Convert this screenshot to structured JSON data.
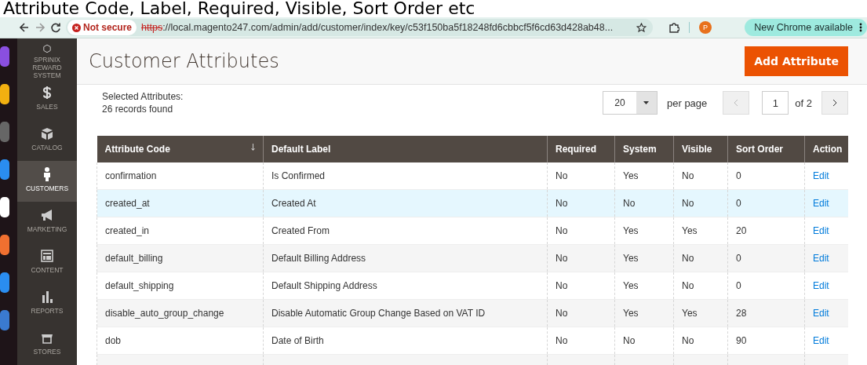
{
  "caption": "Attribute Code, Label, Required, Visible, Sort Order etc",
  "browser": {
    "security": "Not secure",
    "url_scheme": "https",
    "url_rest": "://local.magento247.com/admin/add/customer/index/key/c53f150ba5f18248fd6cbbcf5f6cd63d428ab48...",
    "profile": "P",
    "update": "New Chrome available"
  },
  "sidebar": {
    "items": [
      {
        "kind": "hexagon",
        "label": "SPRINIX REWARD SYSTEM",
        "selected": false
      },
      {
        "kind": "dollar",
        "label": "SALES",
        "selected": false
      },
      {
        "kind": "box",
        "label": "CATALOG",
        "selected": false
      },
      {
        "kind": "person",
        "label": "CUSTOMERS",
        "selected": true
      },
      {
        "kind": "megaphone",
        "label": "MARKETING",
        "selected": false
      },
      {
        "kind": "layout",
        "label": "CONTENT",
        "selected": false
      },
      {
        "kind": "bars",
        "label": "REPORTS",
        "selected": false
      },
      {
        "kind": "store",
        "label": "STORES",
        "selected": false
      }
    ]
  },
  "page": {
    "title": "Customer Attributes",
    "add_button": "Add Attribute"
  },
  "toolbar": {
    "selected_label": "Selected Attributes:",
    "records": "26 records found",
    "per_page_value": "20",
    "per_page_label": "per page",
    "page": "1",
    "of_pages": "of 2"
  },
  "table": {
    "columns": [
      "Attribute Code",
      "Default Label",
      "Required",
      "System",
      "Visible",
      "Sort Order",
      "Action"
    ],
    "rows": [
      {
        "cells": [
          "confirmation",
          "Is Confirmed",
          "No",
          "Yes",
          "No",
          "0"
        ],
        "action": "Edit",
        "selected": false
      },
      {
        "cells": [
          "created_at",
          "Created At",
          "No",
          "No",
          "No",
          "0"
        ],
        "action": "Edit",
        "selected": true
      },
      {
        "cells": [
          "created_in",
          "Created From",
          "No",
          "Yes",
          "Yes",
          "20"
        ],
        "action": "Edit",
        "selected": false
      },
      {
        "cells": [
          "default_billing",
          "Default Billing Address",
          "No",
          "Yes",
          "No",
          "0"
        ],
        "action": "Edit",
        "selected": false
      },
      {
        "cells": [
          "default_shipping",
          "Default Shipping Address",
          "No",
          "Yes",
          "No",
          "0"
        ],
        "action": "Edit",
        "selected": false
      },
      {
        "cells": [
          "disable_auto_group_change",
          "Disable Automatic Group Change Based on VAT ID",
          "No",
          "Yes",
          "Yes",
          "28"
        ],
        "action": "Edit",
        "selected": false
      },
      {
        "cells": [
          "dob",
          "Date of Birth",
          "No",
          "No",
          "No",
          "90"
        ],
        "action": "Edit",
        "selected": false
      }
    ]
  }
}
